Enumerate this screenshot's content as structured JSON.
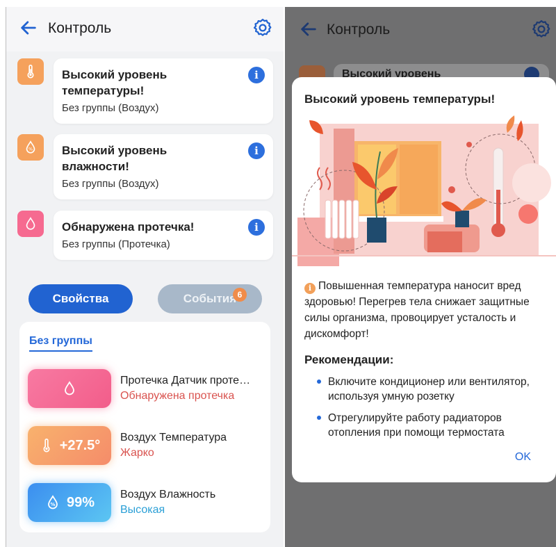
{
  "left": {
    "header": {
      "title": "Контроль"
    },
    "alerts": [
      {
        "title": "Высокий уровень температуры!",
        "group": "Без группы",
        "category": "(Воздух)",
        "icon": "thermometer-icon"
      },
      {
        "title": "Высокий уровень влажности!",
        "group": "Без группы",
        "category": "(Воздух)",
        "icon": "humidity-icon"
      },
      {
        "title": "Обнаружена протечка!",
        "group": "Без группы",
        "category": "(Протечка)",
        "icon": "water-drop-icon"
      }
    ],
    "tabs": {
      "properties": "Свойства",
      "events": "События",
      "events_count": "6"
    },
    "group": {
      "name": "Без группы",
      "sensors": [
        {
          "value": "",
          "name": "Протечка Датчик проте…",
          "state": "Обнаружена протечка",
          "state_color": "#d9534f",
          "icon": "water-drop-icon"
        },
        {
          "value": "+27.5°",
          "name": "Воздух Температура",
          "state": "Жарко",
          "state_color": "#d9534f",
          "icon": "thermometer-icon"
        },
        {
          "value": "99%",
          "name": "Воздух Влажность",
          "state": "Высокая",
          "state_color": "#2a9fd6",
          "icon": "humidity-icon"
        }
      ]
    }
  },
  "right": {
    "header": {
      "title": "Контроль"
    },
    "peek_text": "Высокий уровень",
    "dialog": {
      "title": "Высокий уровень температуры!",
      "note": "Повышенная температура наносит вред здоровью! Перегрев тела снижает защитные силы организма, провоцирует усталость и дискомфорт!",
      "recommendations_title": "Рекомендации:",
      "recommendations": [
        "Включите кондиционер или вентилятор, используя умную розетку",
        "Отрегулируйте работу радиаторов отопления при помощи термостата"
      ],
      "ok": "OK"
    }
  },
  "colors": {
    "accent": "#2163d1",
    "orange": "#f5a15c",
    "pink": "#f66a90",
    "blue": "#4aa8f0"
  }
}
